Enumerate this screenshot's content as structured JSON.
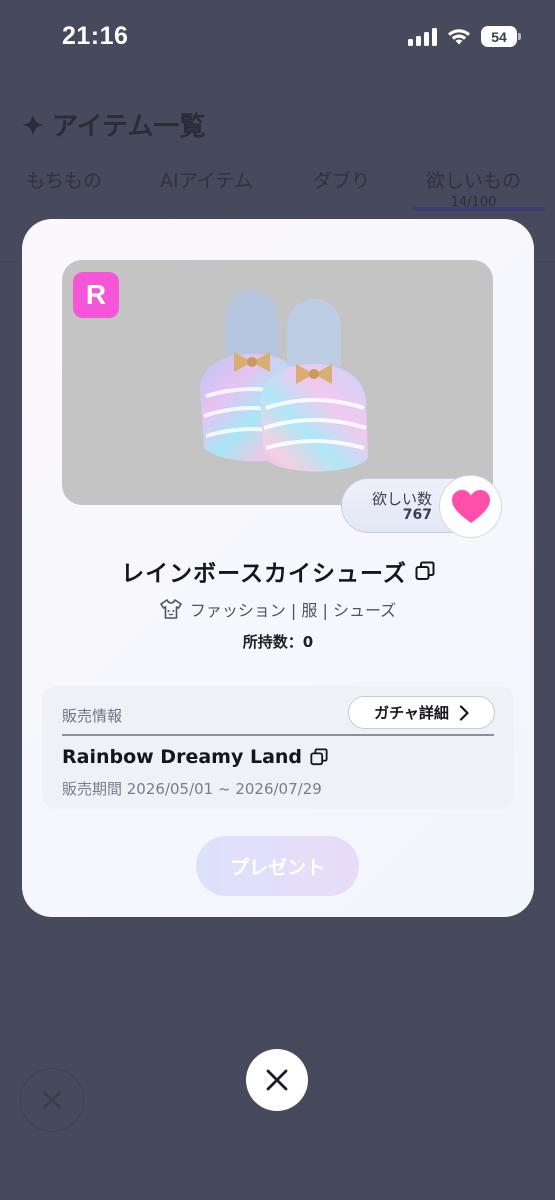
{
  "status_bar": {
    "time": "21:16",
    "battery": "54"
  },
  "background": {
    "title": "アイテム一覧",
    "tabs": [
      {
        "label": "もちもの"
      },
      {
        "label": "AIアイテム"
      },
      {
        "label": "ダブり"
      },
      {
        "label": "欲しいもの",
        "sub": "14/100"
      }
    ]
  },
  "modal": {
    "rarity": "R",
    "wish_label": "欲しい数",
    "wish_count": "767",
    "item_name": "レインボースカイシューズ",
    "category": "ファッション | 服 | シューズ",
    "owned": "所持数：0",
    "sales": {
      "label": "販売情報",
      "gacha_button": "ガチャ詳細",
      "event_name": "Rainbow Dreamy Land",
      "period": "販売期間 2026/05/01 ~ 2026/07/29"
    },
    "present_button": "プレゼント"
  },
  "colors": {
    "accent": "#f556d8",
    "heart": "#ff4fa8",
    "overlay": "#474a5c"
  },
  "icons": [
    "sparkle-icon",
    "heart-icon",
    "copy-icon",
    "shirt-icon",
    "chevron-right-icon",
    "close-icon"
  ]
}
